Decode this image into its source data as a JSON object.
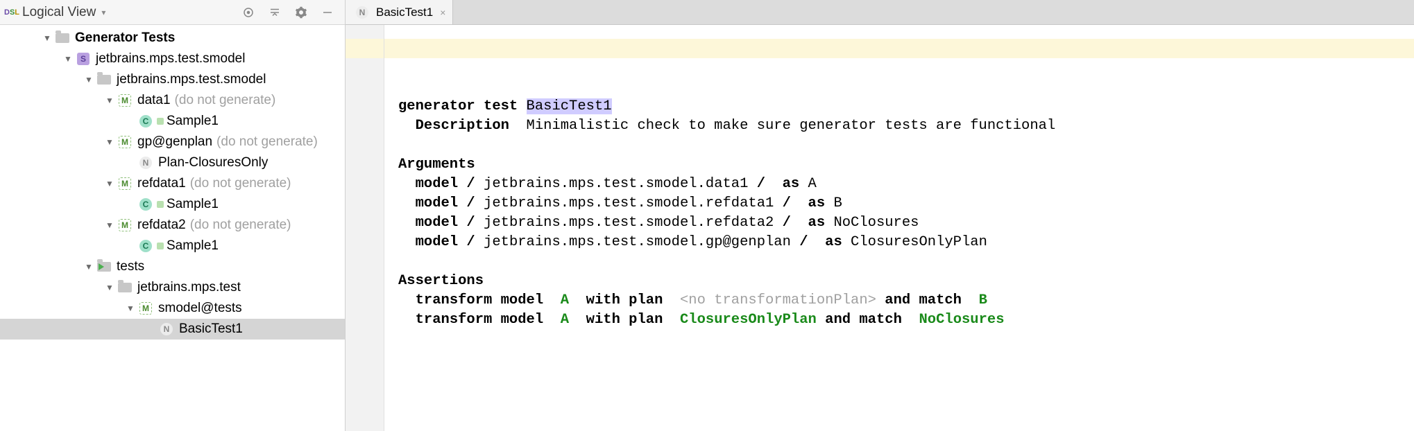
{
  "sidebar": {
    "title": "Logical View",
    "tree": {
      "root": {
        "label": "Generator Tests",
        "solution": {
          "label": "jetbrains.mps.test.smodel",
          "model_folder": {
            "label": "jetbrains.mps.test.smodel",
            "data1": {
              "label": "data1",
              "annot": "(do not generate)",
              "child": "Sample1"
            },
            "gp": {
              "label": "gp@genplan",
              "annot": "(do not generate)",
              "child": "Plan-ClosuresOnly"
            },
            "refdata1": {
              "label": "refdata1",
              "annot": "(do not generate)",
              "child": "Sample1"
            },
            "refdata2": {
              "label": "refdata2",
              "annot": "(do not generate)",
              "child": "Sample1"
            }
          },
          "tests_folder": {
            "label": "tests",
            "pkg": {
              "label": "jetbrains.mps.test",
              "model": {
                "label": "smodel@tests",
                "node": "BasicTest1"
              }
            }
          }
        }
      }
    }
  },
  "tab": {
    "label": "BasicTest1"
  },
  "editor": {
    "header_kw": "generator test",
    "header_name": "BasicTest1",
    "description_kw": "Description",
    "description_text": "Minimalistic check to make sure generator tests are functional",
    "arguments_kw": "Arguments",
    "args": [
      {
        "prefix": "model /",
        "path": "jetbrains.mps.test.smodel.data1",
        "suffix": "/",
        "as_kw": "as",
        "alias": "A"
      },
      {
        "prefix": "model /",
        "path": "jetbrains.mps.test.smodel.refdata1",
        "suffix": "/",
        "as_kw": "as",
        "alias": "B"
      },
      {
        "prefix": "model /",
        "path": "jetbrains.mps.test.smodel.refdata2",
        "suffix": "/",
        "as_kw": "as",
        "alias": "NoClosures"
      },
      {
        "prefix": "model /",
        "path": "jetbrains.mps.test.smodel.gp@genplan",
        "suffix": "/",
        "as_kw": "as",
        "alias": "ClosuresOnlyPlan"
      }
    ],
    "assertions_kw": "Assertions",
    "assertions": [
      {
        "kw1": "transform model",
        "m": "A",
        "kw2": "with plan",
        "plan": "<no transformationPlan>",
        "plan_gray": true,
        "kw3": "and match",
        "match": "B"
      },
      {
        "kw1": "transform model",
        "m": "A",
        "kw2": "with plan",
        "plan": "ClosuresOnlyPlan",
        "plan_gray": false,
        "kw3": "and match",
        "match": "NoClosures"
      }
    ]
  }
}
